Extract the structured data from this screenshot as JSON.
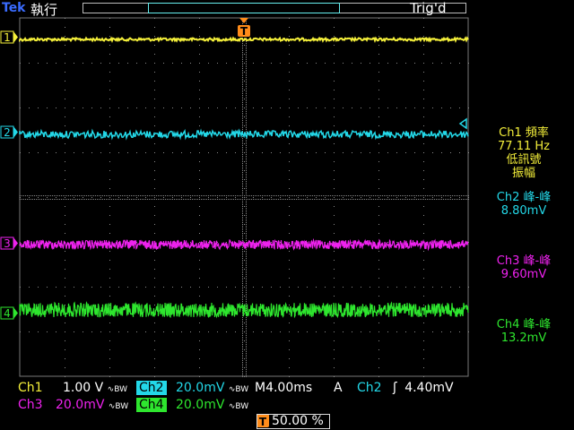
{
  "header": {
    "brand": "Tek",
    "run_state": "執行",
    "trigger_status": "Trig'd"
  },
  "colors": {
    "ch1": "#f5f03a",
    "ch2": "#23d8e8",
    "ch3": "#ee22ee",
    "ch4": "#2ee62e",
    "trigger": "#ff8c1a",
    "grid": "#888888"
  },
  "channel_markers": [
    "1",
    "2",
    "3",
    "4"
  ],
  "trigger_marker": "T",
  "measurements": {
    "ch1_label": "Ch1 頻率",
    "ch1_value": "77.11 Hz",
    "ch1_note1": "低訊號",
    "ch1_note2": "振幅",
    "ch2_label": "Ch2 峰-峰",
    "ch2_value": "8.80mV",
    "ch3_label": "Ch3 峰-峰",
    "ch3_value": "9.60mV",
    "ch4_label": "Ch4 峰-峰",
    "ch4_value": "13.2mV"
  },
  "readouts": {
    "ch1_name": "Ch1",
    "ch1_scale": "1.00 V",
    "ch2_name": "Ch2",
    "ch2_scale": "20.0mV",
    "ch3_name": "Ch3",
    "ch3_scale": "20.0mV",
    "ch4_name": "Ch4",
    "ch4_scale": "20.0mV",
    "bw_symbol": "∿BW",
    "timebase": "M4.00ms",
    "trigger_mode": "A",
    "trigger_source": "Ch2",
    "trigger_slope": "ʃ",
    "trigger_level": "4.40mV",
    "trigger_position": "50.00 %"
  }
}
